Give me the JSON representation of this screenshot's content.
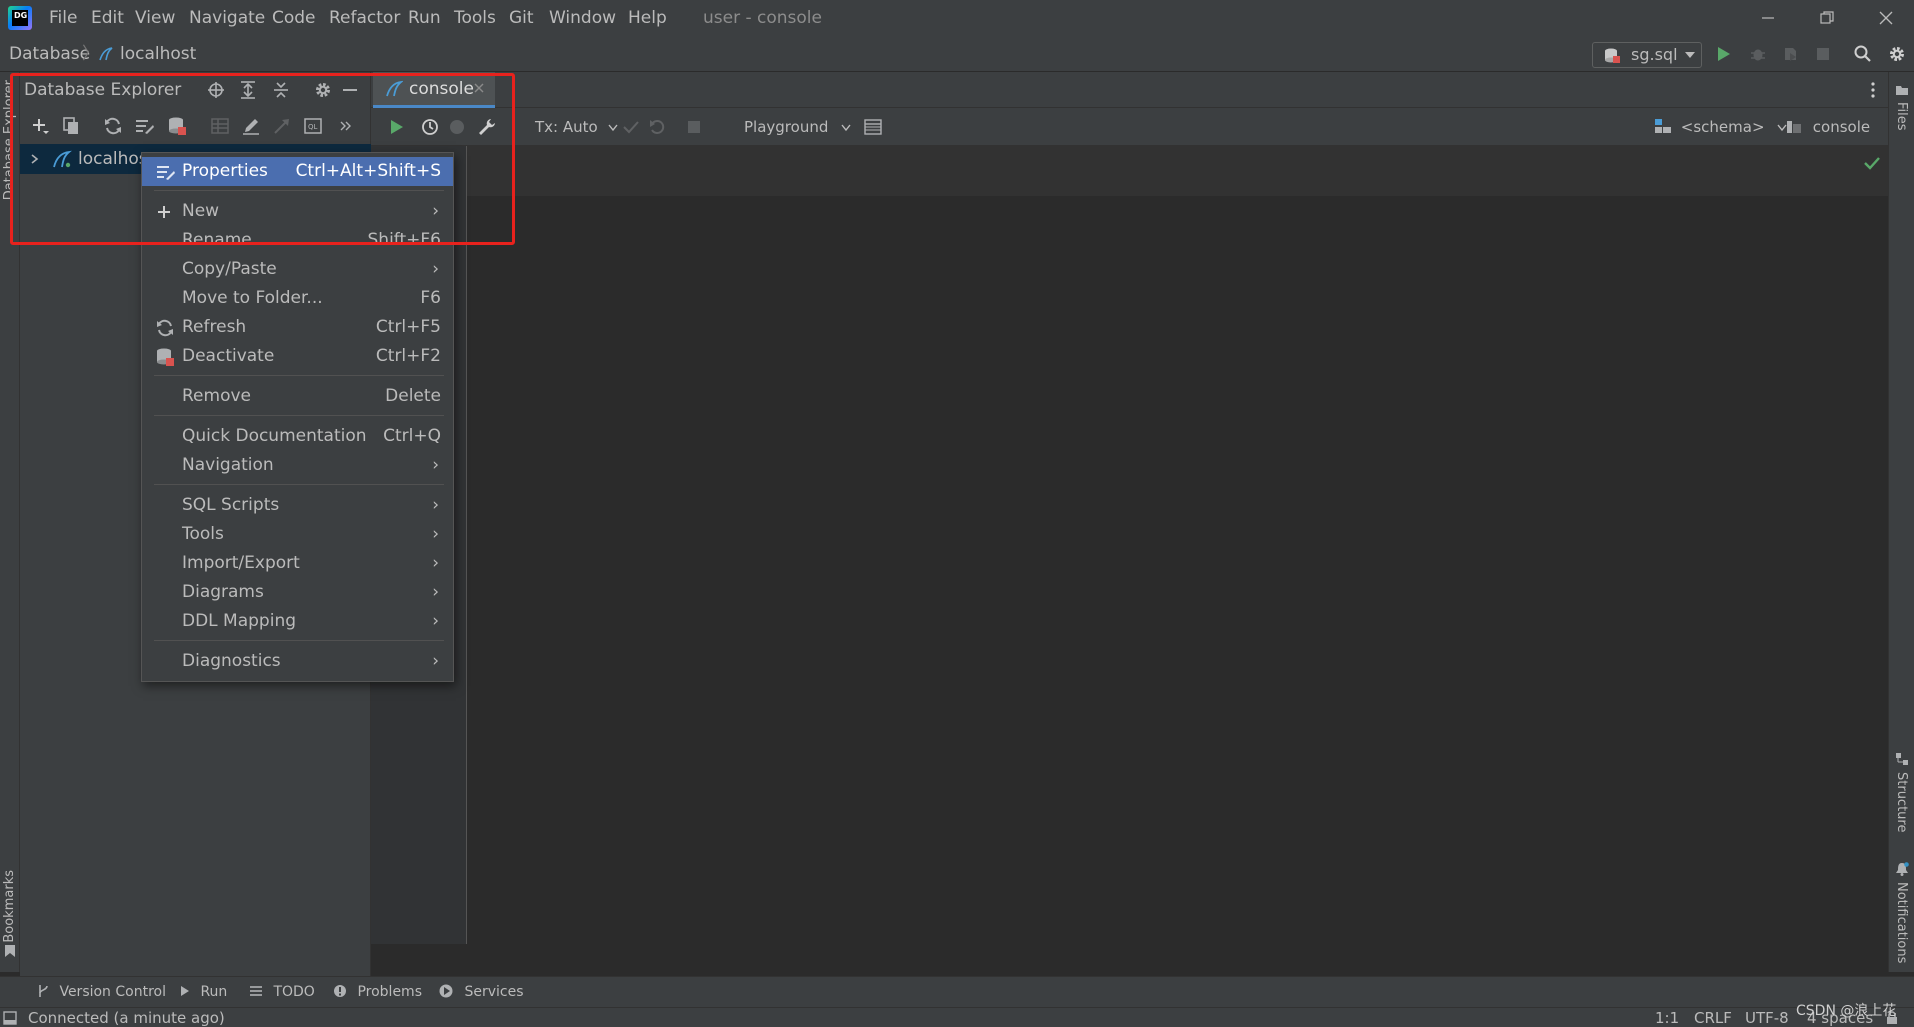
{
  "titlebar": {
    "menus": [
      "File",
      "Edit",
      "View",
      "Navigate",
      "Code",
      "Refactor",
      "Run",
      "Tools",
      "Git",
      "Window",
      "Help"
    ],
    "window_title": "user - console"
  },
  "navbar": {
    "breadcrumb_root": "Database",
    "breadcrumb_separator": "〉",
    "breadcrumb_leaf": "localhost",
    "run_config": "sg.sql"
  },
  "left_stripe": {
    "top_label": "Database Explorer",
    "bottom_label": "Bookmarks"
  },
  "right_stripe": {
    "files": "Files",
    "structure": "Structure",
    "notifications": "Notifications"
  },
  "db_panel": {
    "title": "Database Explorer",
    "tree_item": "localhos"
  },
  "editor": {
    "tab_label": "console",
    "tx_mode": "Tx: Auto",
    "playground": "Playground",
    "schema": "<schema>",
    "session": "console"
  },
  "context_menu": {
    "items": [
      {
        "label": "Properties",
        "shortcut": "Ctrl+Alt+Shift+S"
      },
      {
        "label": "New",
        "shortcut": ""
      },
      {
        "label": "Rename...",
        "shortcut": "Shift+F6"
      },
      {
        "label": "Copy/Paste",
        "shortcut": ""
      },
      {
        "label": "Move to Folder...",
        "shortcut": "F6"
      },
      {
        "label": "Refresh",
        "shortcut": "Ctrl+F5"
      },
      {
        "label": "Deactivate",
        "shortcut": "Ctrl+F2"
      },
      {
        "label": "Remove",
        "shortcut": "Delete"
      },
      {
        "label": "Quick Documentation",
        "shortcut": "Ctrl+Q"
      },
      {
        "label": "Navigation",
        "shortcut": ""
      },
      {
        "label": "SQL Scripts",
        "shortcut": ""
      },
      {
        "label": "Tools",
        "shortcut": ""
      },
      {
        "label": "Import/Export",
        "shortcut": ""
      },
      {
        "label": "Diagrams",
        "shortcut": ""
      },
      {
        "label": "DDL Mapping",
        "shortcut": ""
      },
      {
        "label": "Diagnostics",
        "shortcut": ""
      }
    ],
    "arrow": "›"
  },
  "tool_tabs": [
    "Version Control",
    "Run",
    "TODO",
    "Problems",
    "Services"
  ],
  "statusbar": {
    "message": "Connected (a minute ago)",
    "position": "1:1",
    "line_sep": "CRLF",
    "encoding": "UTF-8",
    "indent": "4 spaces"
  },
  "watermark": "CSDN @浪上花",
  "colors": {
    "accent": "#4b6eaf",
    "highlight": "#e8221d",
    "run_green": "#59a869"
  }
}
